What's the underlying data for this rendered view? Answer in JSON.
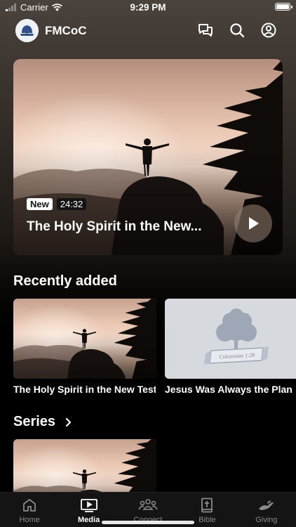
{
  "status_bar": {
    "carrier": "Carrier",
    "time": "9:29 PM"
  },
  "header": {
    "brand": "FMCoC"
  },
  "hero": {
    "badge_new": "New",
    "duration": "24:32",
    "title": "The Holy Spirit in the New..."
  },
  "recently_added": {
    "title": "Recently added",
    "items": [
      {
        "title": "The Holy Spirit in the New Testament"
      },
      {
        "title": "Jesus Was Always the Plan",
        "art_caption": "Colossians 1:28"
      }
    ]
  },
  "series": {
    "title": "Series"
  },
  "tab_bar": {
    "tabs": [
      {
        "label": "Home",
        "icon": "home-icon"
      },
      {
        "label": "Media",
        "icon": "media-icon",
        "active": true
      },
      {
        "label": "Connect",
        "icon": "people-icon"
      },
      {
        "label": "Bible",
        "icon": "bible-icon"
      },
      {
        "label": "Giving",
        "icon": "giving-icon"
      }
    ]
  },
  "colors": {
    "background": "#000000",
    "tab_bar": "#141414",
    "inactive_tab": "#8a8a8a",
    "placeholder_card": "#d6dade"
  }
}
